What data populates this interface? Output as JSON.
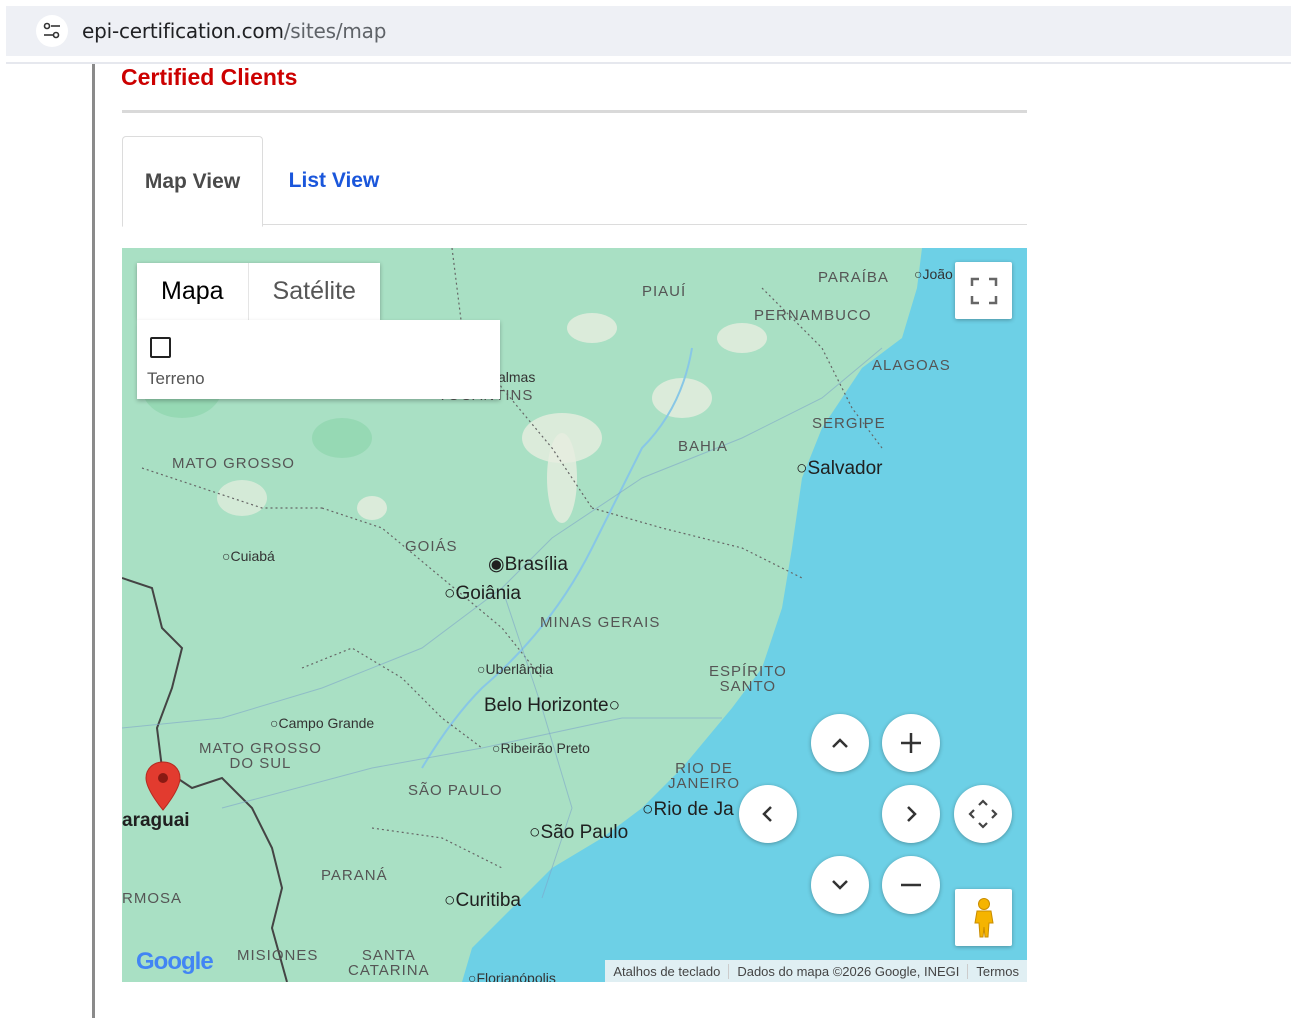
{
  "browser": {
    "url_domain": "epi-certification.com",
    "url_path": "/sites/map"
  },
  "page": {
    "title": "Certified Clients"
  },
  "tabs": {
    "map_view": "Map View",
    "list_view": "List View"
  },
  "map": {
    "type_map": "Mapa",
    "type_satellite": "Satélite",
    "terrain_label": "Terreno",
    "states": {
      "paraiba": "PARAÍBA",
      "piaui": "PIAUÍ",
      "pernambuco": "PERNAMBUCO",
      "alagoas": "ALAGOAS",
      "sergipe": "SERGIPE",
      "bahia": "BAHIA",
      "tocantins": "TOCANTINS",
      "mato_grosso": "MATO GROSSO",
      "goias": "GOIÁS",
      "minas_gerais": "MINAS GERAIS",
      "espirito_santo_1": "ESPÍRITO",
      "espirito_santo_2": "SANTO",
      "ms_1": "MATO GROSSO",
      "ms_2": "DO SUL",
      "rio_1": "RIO DE",
      "rio_2": "JANEIRO",
      "sao_paulo": "SÃO PAULO",
      "parana": "PARANÁ",
      "misiones": "MISIONES",
      "sc_1": "SANTA",
      "sc_2": "CATARINA",
      "formosa": "RMOSA"
    },
    "cities": {
      "joao": "João",
      "palmas": "almas",
      "salvador": "Salvador",
      "cuiaba": "Cuiabá",
      "brasilia": "Brasília",
      "goiania": "Goiânia",
      "uberlandia": "Uberlândia",
      "belo_horizonte": "Belo Horizonte",
      "campo_grande": "Campo Grande",
      "ribeirao": "Ribeirão Preto",
      "rio": "Rio de Ja",
      "sao_paulo": "São Paulo",
      "curitiba": "Curitiba",
      "paraguai": "araguai",
      "florianopolis": "Florianópolis"
    },
    "footer": {
      "shortcuts": "Atalhos de teclado",
      "data": "Dados do mapa ©2026 Google, INEGI",
      "terms": "Termos"
    },
    "logo": "Google"
  }
}
